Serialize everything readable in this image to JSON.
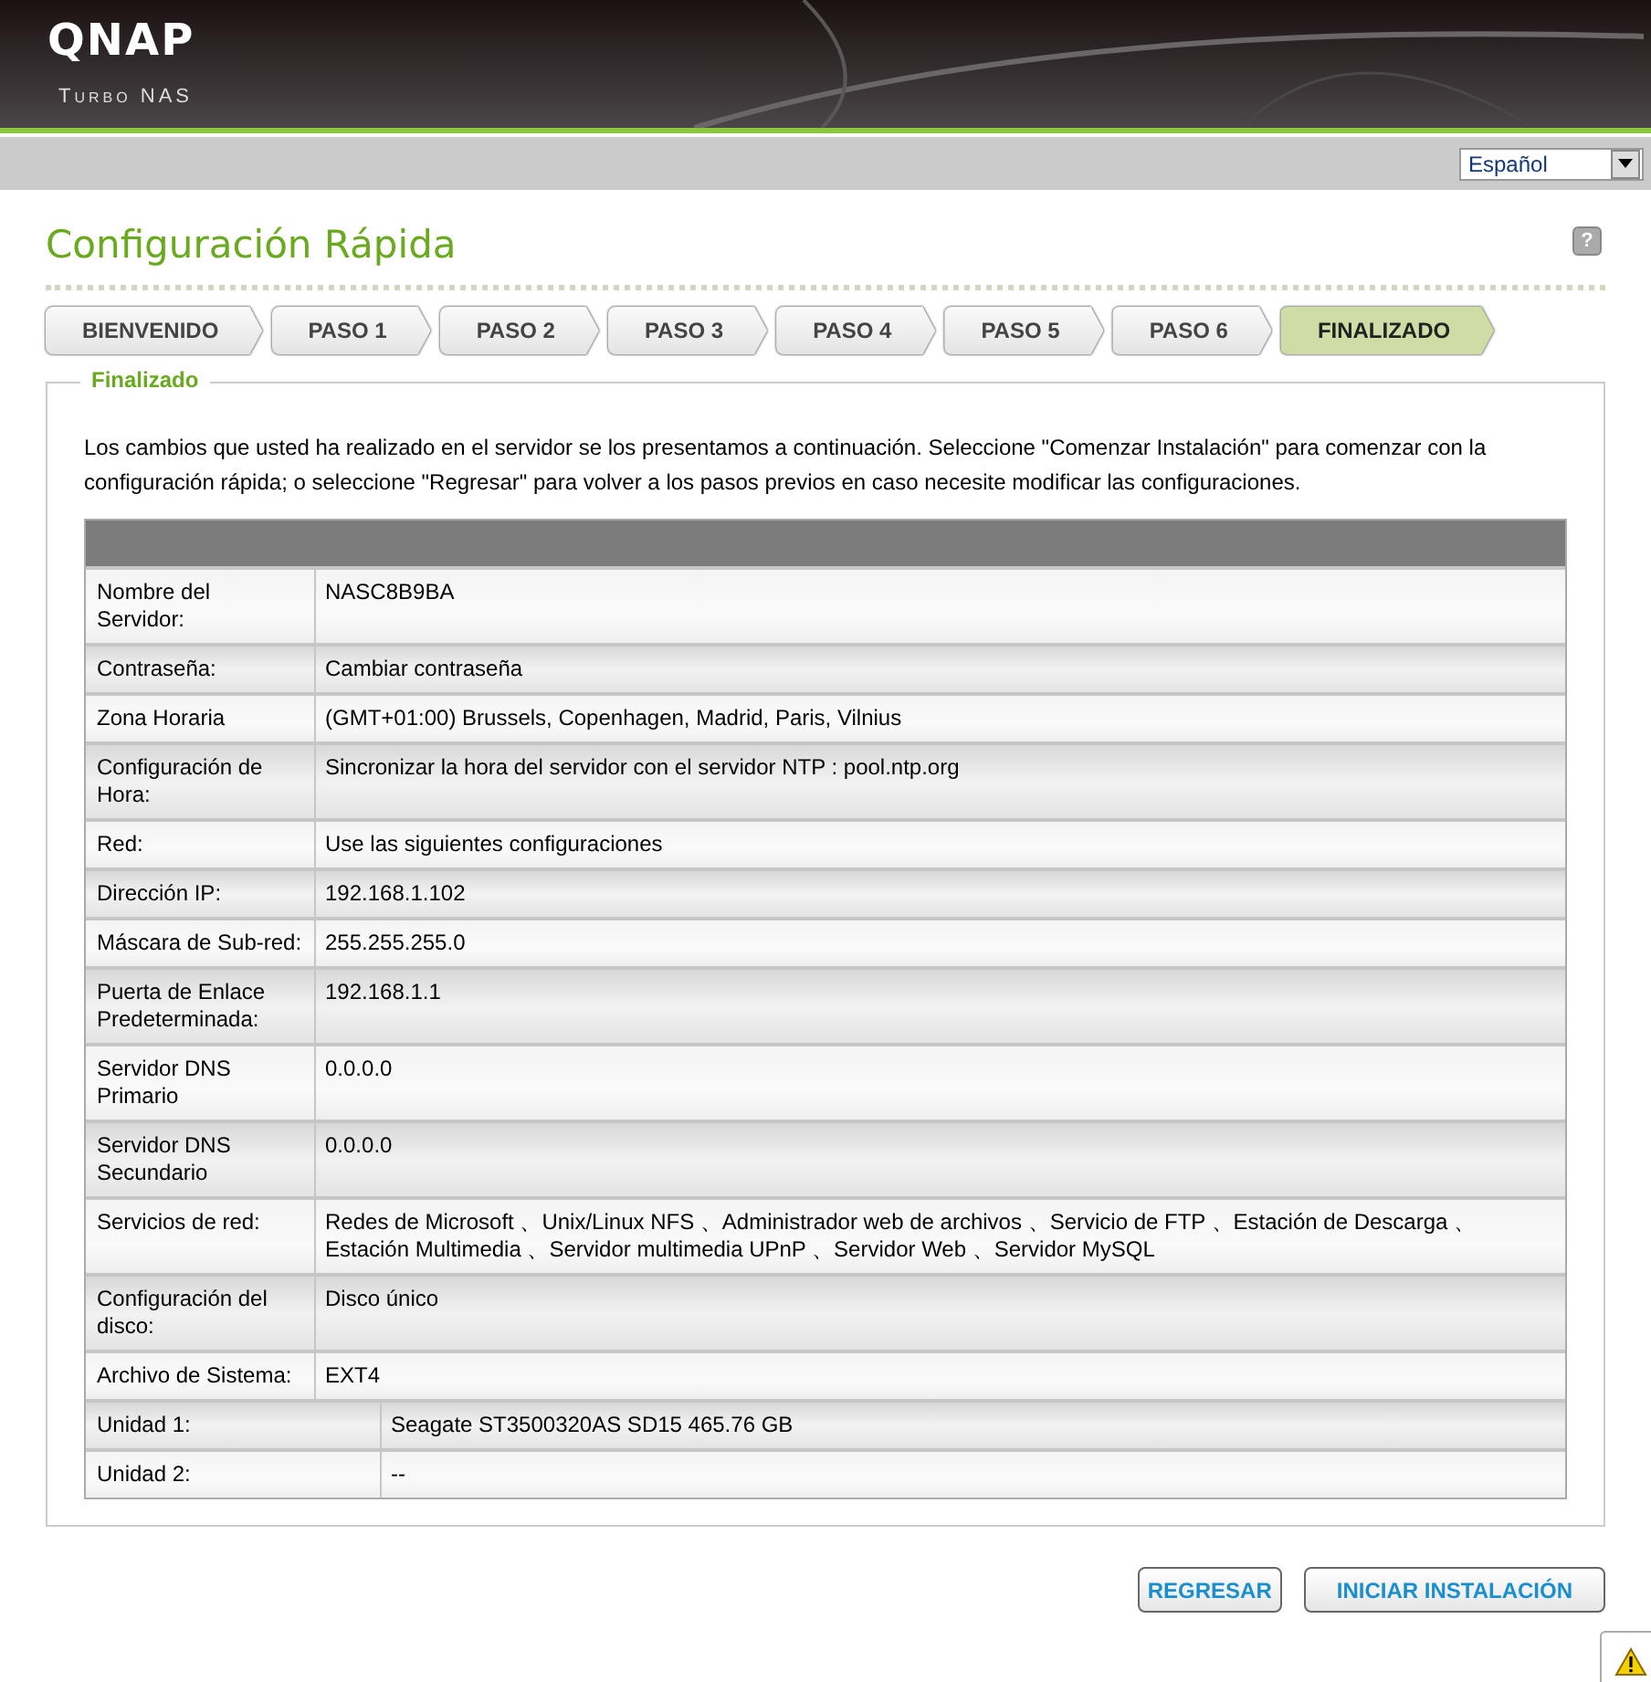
{
  "header": {
    "logo": "QNAP",
    "subtitle": "Turbo NAS"
  },
  "language": {
    "value": "Español"
  },
  "title": "Configuración Rápida",
  "help": "?",
  "tabs": [
    {
      "label": "BIENVENIDO",
      "selected": false
    },
    {
      "label": "PASO 1",
      "selected": false
    },
    {
      "label": "PASO 2",
      "selected": false
    },
    {
      "label": "PASO 3",
      "selected": false
    },
    {
      "label": "PASO 4",
      "selected": false
    },
    {
      "label": "PASO 5",
      "selected": false
    },
    {
      "label": "PASO 6",
      "selected": false
    },
    {
      "label": "FINALIZADO",
      "selected": true
    }
  ],
  "panel": {
    "legend": "Finalizado",
    "intro": "Los cambios que usted ha realizado en el servidor se los presentamos a continuación. Seleccione \"Comenzar Instalación\" para comenzar con la configuración rápida; o seleccione \"Regresar\" para volver a los pasos previos en caso necesite modificar las configuraciones."
  },
  "table": {
    "rows": [
      {
        "kind": "setting",
        "label": "Nombre del Servidor:",
        "value": "NASC8B9BA"
      },
      {
        "kind": "setting",
        "label": "Contraseña:",
        "value": "Cambiar contraseña"
      },
      {
        "kind": "setting",
        "label": "Zona Horaria",
        "value": "(GMT+01:00) Brussels, Copenhagen, Madrid, Paris, Vilnius"
      },
      {
        "kind": "setting",
        "label": "Configuración de Hora:",
        "value": "Sincronizar la hora del servidor con el servidor NTP : pool.ntp.org"
      },
      {
        "kind": "setting",
        "label": "Red:",
        "value": "Use las siguientes configuraciones"
      },
      {
        "kind": "setting",
        "label": "Dirección IP:",
        "value": "192.168.1.102"
      },
      {
        "kind": "setting",
        "label": "Máscara de Sub-red:",
        "value": "255.255.255.0"
      },
      {
        "kind": "setting",
        "label": "Puerta de Enlace Predeterminada:",
        "value": "192.168.1.1"
      },
      {
        "kind": "setting",
        "label": "Servidor DNS Primario",
        "value": "0.0.0.0"
      },
      {
        "kind": "setting",
        "label": "Servidor DNS Secundario",
        "value": "0.0.0.0"
      },
      {
        "kind": "setting",
        "label": "Servicios de red:",
        "value": "Redes de Microsoft 、Unix/Linux NFS 、Administrador web de archivos 、Servicio de FTP 、Estación de Descarga 、Estación Multimedia 、Servidor multimedia UPnP 、Servidor Web 、Servidor MySQL"
      },
      {
        "kind": "setting",
        "label": "Configuración del disco:",
        "value": "Disco único"
      },
      {
        "kind": "setting",
        "label": "Archivo de Sistema:",
        "value": "EXT4"
      },
      {
        "kind": "drive",
        "label": "Unidad 1:",
        "value": "Seagate ST3500320AS SD15 465.76 GB"
      },
      {
        "kind": "drive",
        "label": "Unidad 2:",
        "value": "--"
      }
    ]
  },
  "buttons": [
    {
      "label": "REGRESAR"
    },
    {
      "label": "INICIAR INSTALACIÓN"
    }
  ]
}
